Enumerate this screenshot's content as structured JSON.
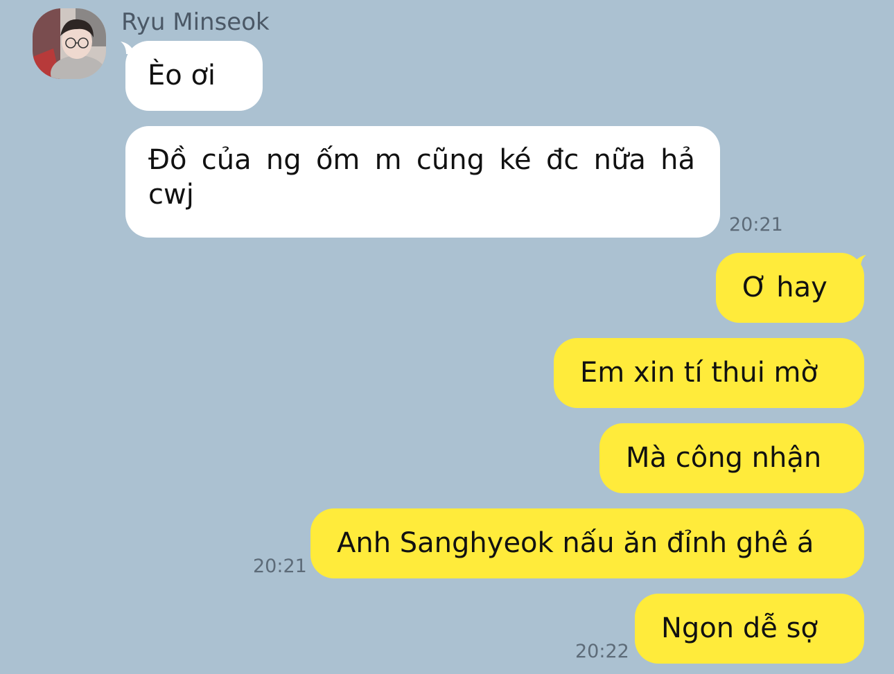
{
  "conversation": {
    "sender_name": "Ryu Minseok",
    "avatar_icon": "profile-photo",
    "colors": {
      "background": "#abc1d1",
      "incoming_bubble": "#ffffff",
      "outgoing_bubble": "#ffeb3b",
      "timestamp": "#5d6b78"
    },
    "messages": [
      {
        "direction": "in",
        "text": "Èo ơi",
        "time": ""
      },
      {
        "direction": "in",
        "text": "Đồ của ng ốm m cũng ké đc nữa hả cwj",
        "time": "20:21"
      },
      {
        "direction": "out",
        "text": "Ơ hay",
        "time": ""
      },
      {
        "direction": "out",
        "text": "Em xin tí thui mờ",
        "time": ""
      },
      {
        "direction": "out",
        "text": "Mà công nhận",
        "time": ""
      },
      {
        "direction": "out",
        "text": "Anh Sanghyeok nấu ăn đỉnh ghê á",
        "time": "20:21"
      },
      {
        "direction": "out",
        "text": "Ngon dễ sợ",
        "time": "20:22"
      }
    ]
  }
}
